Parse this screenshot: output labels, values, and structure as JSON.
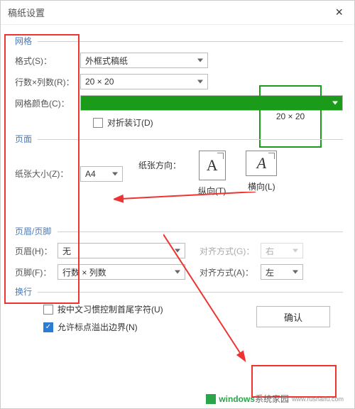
{
  "titlebar": {
    "title": "稿纸设置",
    "close": "×"
  },
  "sections": {
    "grid": "网格",
    "page": "页面",
    "headerFooter": "页眉/页脚",
    "wrap": "换行"
  },
  "grid": {
    "formatLabel": "格式(S)：",
    "formatValue": "外框式稿纸",
    "rowsColsLabel": "行数×列数(R)：",
    "rowsColsValue": "20 × 20",
    "colorLabel": "网格颜色(C)：",
    "colorValue": "#1a9b1a",
    "foldBind": "对折装订(D)",
    "preview": "20 × 20"
  },
  "page": {
    "sizeLabel": "纸张大小(Z)：",
    "sizeValue": "A4",
    "orientLabel": "纸张方向：",
    "portraitGlyph": "A",
    "portrait": "纵向(T)",
    "landscapeGlyph": "A",
    "landscape": "横向(L)"
  },
  "hf": {
    "headerLabel": "页眉(H)：",
    "headerValue": "无",
    "footerLabel": "页脚(F)：",
    "footerValue": "行数 × 列数",
    "alignLabelG": "对齐方式(G)：",
    "alignValueG": "右",
    "alignLabelA": "对齐方式(A)：",
    "alignValueA": "左"
  },
  "wrap": {
    "cjk": "按中文习惯控制首尾字符(U)",
    "overflow": "允许标点溢出边界(N)"
  },
  "buttons": {
    "ok": "确认"
  },
  "watermark": {
    "brand": "windows",
    "suffix": "系统家园",
    "url": "www.rushaifu.com"
  }
}
